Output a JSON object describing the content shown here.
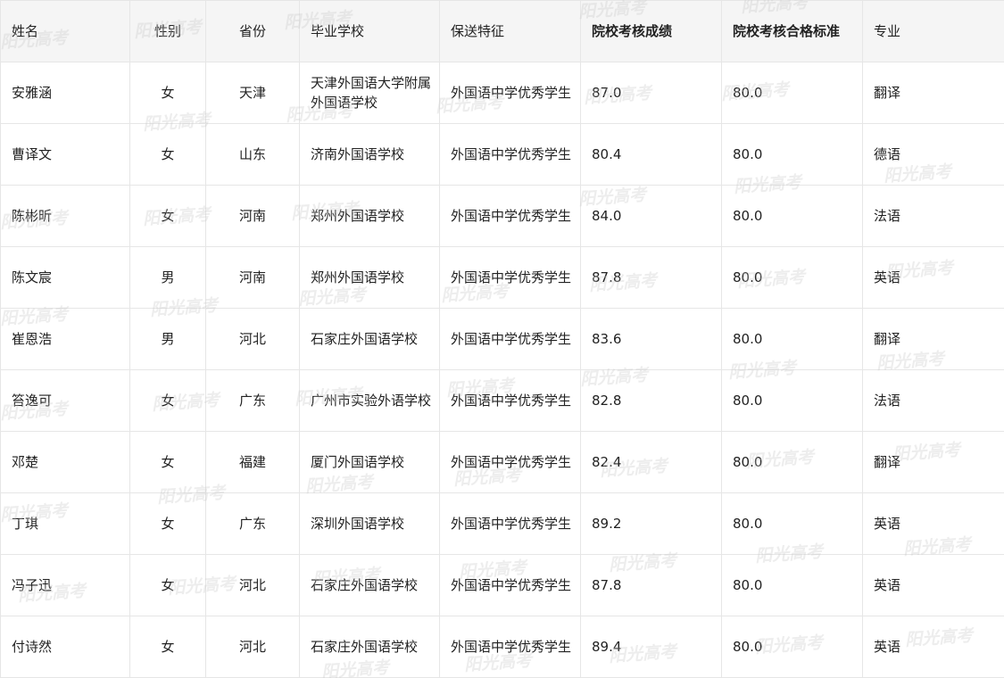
{
  "watermark": "阳光高考",
  "table": {
    "headers": {
      "name": "姓名",
      "gender": "性别",
      "province": "省份",
      "school": "毕业学校",
      "feature": "保送特征",
      "score": "院校考核成绩",
      "standard": "院校考核合格标准",
      "major": "专业"
    },
    "rows": [
      {
        "name": "安雅涵",
        "gender": "女",
        "province": "天津",
        "school": "天津外国语大学附属外国语学校",
        "feature": "外国语中学优秀学生",
        "score": "87.0",
        "standard": "80.0",
        "major": "翻译"
      },
      {
        "name": "曹译文",
        "gender": "女",
        "province": "山东",
        "school": "济南外国语学校",
        "feature": "外国语中学优秀学生",
        "score": "80.4",
        "standard": "80.0",
        "major": "德语"
      },
      {
        "name": "陈彬昕",
        "gender": "女",
        "province": "河南",
        "school": "郑州外国语学校",
        "feature": "外国语中学优秀学生",
        "score": "84.0",
        "standard": "80.0",
        "major": "法语"
      },
      {
        "name": "陈文宸",
        "gender": "男",
        "province": "河南",
        "school": "郑州外国语学校",
        "feature": "外国语中学优秀学生",
        "score": "87.8",
        "standard": "80.0",
        "major": "英语"
      },
      {
        "name": "崔恩浩",
        "gender": "男",
        "province": "河北",
        "school": "石家庄外国语学校",
        "feature": "外国语中学优秀学生",
        "score": "83.6",
        "standard": "80.0",
        "major": "翻译"
      },
      {
        "name": "笞逸可",
        "gender": "女",
        "province": "广东",
        "school": "广州市实验外语学校",
        "feature": "外国语中学优秀学生",
        "score": "82.8",
        "standard": "80.0",
        "major": "法语"
      },
      {
        "name": "邓楚",
        "gender": "女",
        "province": "福建",
        "school": "厦门外国语学校",
        "feature": "外国语中学优秀学生",
        "score": "82.4",
        "standard": "80.0",
        "major": "翻译"
      },
      {
        "name": "丁琪",
        "gender": "女",
        "province": "广东",
        "school": "深圳外国语学校",
        "feature": "外国语中学优秀学生",
        "score": "89.2",
        "standard": "80.0",
        "major": "英语"
      },
      {
        "name": "冯子迅",
        "gender": "女",
        "province": "河北",
        "school": "石家庄外国语学校",
        "feature": "外国语中学优秀学生",
        "score": "87.8",
        "standard": "80.0",
        "major": "英语"
      },
      {
        "name": "付诗然",
        "gender": "女",
        "province": "河北",
        "school": "石家庄外国语学校",
        "feature": "外国语中学优秀学生",
        "score": "89.4",
        "standard": "80.0",
        "major": "英语"
      }
    ]
  }
}
